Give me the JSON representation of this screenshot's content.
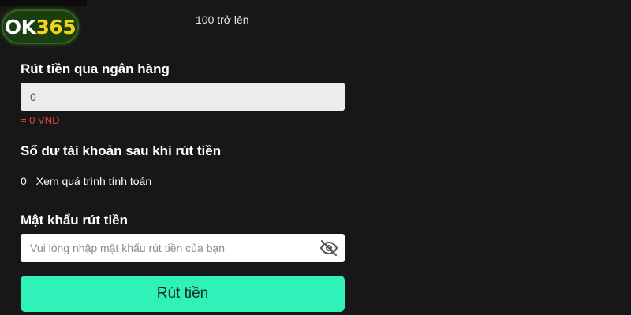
{
  "brand": {
    "logo_part1": "OK",
    "logo_part2": "365",
    "accent_color": "#f2d21b"
  },
  "header": {
    "note": "100 trở lên"
  },
  "withdraw": {
    "section_title": "Rút tiền qua ngân hàng",
    "amount_value": "0",
    "converted": "= 0 VND"
  },
  "balance": {
    "section_title": "Số dư tài khoản sau khi rút tiền",
    "value": "0",
    "calc_link": "Xem quá trình tính toán"
  },
  "password": {
    "section_title": "Mật khẩu rút tiền",
    "placeholder": "Vui lòng nhập mật khẩu rút tiền của bạn",
    "toggle_icon": "eye-slash-icon"
  },
  "submit": {
    "label": "Rút tiền",
    "color": "#2ef2b8"
  }
}
